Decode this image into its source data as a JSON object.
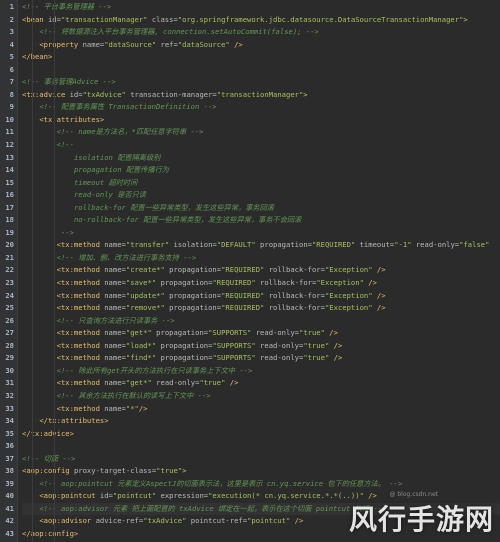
{
  "colors": {
    "background": "#2b2b2b",
    "gutter": "#313335",
    "tag": "#e8bf6a",
    "attribute": "#bababa",
    "value": "#a5c25c",
    "comment": "#629755"
  },
  "lines": [
    {
      "n": "1",
      "tokens": [
        [
          "cmt",
          "<!-- 平台事务管理器 -->"
        ]
      ]
    },
    {
      "n": "2",
      "tokens": [
        [
          "tag",
          "<bean "
        ],
        [
          "attr",
          "id="
        ],
        [
          "val",
          "\"transactionManager\""
        ],
        [
          "attr",
          " class="
        ],
        [
          "val",
          "\"org.springframework.jdbc.datasource.DataSourceTransactionManager\""
        ],
        [
          "tag",
          ">"
        ]
      ]
    },
    {
      "n": "3",
      "tokens": [
        [
          "plain",
          "    "
        ],
        [
          "cmt",
          "<!-- 将数据源注入平台事务管理器, connection.setAutoCommit(false); -->"
        ]
      ]
    },
    {
      "n": "4",
      "tokens": [
        [
          "plain",
          "    "
        ],
        [
          "tag",
          "<property "
        ],
        [
          "attr",
          "name="
        ],
        [
          "val",
          "\"dataSource\""
        ],
        [
          "attr",
          " ref="
        ],
        [
          "val",
          "\"dataSource\""
        ],
        [
          "tag",
          " />"
        ]
      ]
    },
    {
      "n": "5",
      "tokens": [
        [
          "tag",
          "</bean>"
        ]
      ]
    },
    {
      "n": "6",
      "tokens": []
    },
    {
      "n": "7",
      "tokens": [
        [
          "cmt",
          "<!-- 事务管理Advice -->"
        ]
      ]
    },
    {
      "n": "8",
      "tokens": [
        [
          "tag",
          "<tx:advice "
        ],
        [
          "attr",
          "id="
        ],
        [
          "val",
          "\"txAdvice\""
        ],
        [
          "attr",
          " transaction-manager="
        ],
        [
          "val",
          "\"transactionManager\""
        ],
        [
          "tag",
          ">"
        ]
      ]
    },
    {
      "n": "9",
      "tokens": [
        [
          "plain",
          "    "
        ],
        [
          "cmt",
          "<!-- 配置事务属性 TransactionDefinition -->"
        ]
      ]
    },
    {
      "n": "10",
      "tokens": [
        [
          "plain",
          "    "
        ],
        [
          "tag",
          "<tx:attributes>"
        ]
      ]
    },
    {
      "n": "11",
      "tokens": [
        [
          "plain",
          "        "
        ],
        [
          "cmt",
          "<!-- name是方法名，*匹配任意字符串 -->"
        ]
      ]
    },
    {
      "n": "12",
      "tokens": [
        [
          "plain",
          "        "
        ],
        [
          "cmt",
          "<!--"
        ]
      ]
    },
    {
      "n": "13",
      "tokens": [
        [
          "plain",
          "            "
        ],
        [
          "cmt",
          "isolation 配置隔离级别"
        ]
      ]
    },
    {
      "n": "14",
      "tokens": [
        [
          "plain",
          "            "
        ],
        [
          "cmt",
          "propagation 配置传播行为"
        ]
      ]
    },
    {
      "n": "15",
      "tokens": [
        [
          "plain",
          "            "
        ],
        [
          "cmt",
          "timeout 超时时间"
        ]
      ]
    },
    {
      "n": "16",
      "tokens": [
        [
          "plain",
          "            "
        ],
        [
          "cmt",
          "read-only 是否只读"
        ]
      ]
    },
    {
      "n": "17",
      "tokens": [
        [
          "plain",
          "            "
        ],
        [
          "cmt",
          "rollback-for 配置一些异常类型，发生这些异常，事务回滚"
        ]
      ]
    },
    {
      "n": "18",
      "tokens": [
        [
          "plain",
          "            "
        ],
        [
          "cmt",
          "no-rollback-for 配置一些异常类型，发生这些异常，事务不会回滚"
        ]
      ]
    },
    {
      "n": "19",
      "tokens": [
        [
          "plain",
          "         "
        ],
        [
          "cmt",
          "-->"
        ]
      ]
    },
    {
      "n": "20",
      "tokens": [
        [
          "plain",
          "        "
        ],
        [
          "tag",
          "<tx:method "
        ],
        [
          "attr",
          "name="
        ],
        [
          "val",
          "\"transfer\""
        ],
        [
          "attr",
          " isolation="
        ],
        [
          "val",
          "\"DEFAULT\""
        ],
        [
          "attr",
          " propagation="
        ],
        [
          "val",
          "\"REQUIRED\""
        ],
        [
          "attr",
          " timeout="
        ],
        [
          "val",
          "\"-1\""
        ],
        [
          "attr",
          " read-only="
        ],
        [
          "val",
          "\"false\""
        ]
      ]
    },
    {
      "n": "21",
      "tokens": [
        [
          "plain",
          "        "
        ],
        [
          "cmt",
          "<!-- 增加、删、改方法进行事务支持 -->"
        ]
      ]
    },
    {
      "n": "22",
      "tokens": [
        [
          "plain",
          "        "
        ],
        [
          "tag",
          "<tx:method "
        ],
        [
          "attr",
          "name="
        ],
        [
          "val",
          "\"create*\""
        ],
        [
          "attr",
          " propagation="
        ],
        [
          "val",
          "\"REQUIRED\""
        ],
        [
          "attr",
          " rollback-for="
        ],
        [
          "val",
          "\"Exception\""
        ],
        [
          "tag",
          " />"
        ]
      ]
    },
    {
      "n": "23",
      "tokens": [
        [
          "plain",
          "        "
        ],
        [
          "tag",
          "<tx:method "
        ],
        [
          "attr",
          "name="
        ],
        [
          "val",
          "\"save*\""
        ],
        [
          "attr",
          " propagation="
        ],
        [
          "val",
          "\"REQUIRED\""
        ],
        [
          "attr",
          " rollback-for="
        ],
        [
          "val",
          "\"Exception\""
        ],
        [
          "tag",
          " />"
        ]
      ]
    },
    {
      "n": "24",
      "tokens": [
        [
          "plain",
          "        "
        ],
        [
          "tag",
          "<tx:method "
        ],
        [
          "attr",
          "name="
        ],
        [
          "val",
          "\"update*\""
        ],
        [
          "attr",
          " propagation="
        ],
        [
          "val",
          "\"REQUIRED\""
        ],
        [
          "attr",
          " rollback-for="
        ],
        [
          "val",
          "\"Exception\""
        ],
        [
          "tag",
          " />"
        ]
      ]
    },
    {
      "n": "25",
      "tokens": [
        [
          "plain",
          "        "
        ],
        [
          "tag",
          "<tx:method "
        ],
        [
          "attr",
          "name="
        ],
        [
          "val",
          "\"remove*\""
        ],
        [
          "attr",
          " propagation="
        ],
        [
          "val",
          "\"REQUIRED\""
        ],
        [
          "attr",
          " rollback-for="
        ],
        [
          "val",
          "\"Exception\""
        ],
        [
          "tag",
          " />"
        ]
      ]
    },
    {
      "n": "26",
      "tokens": [
        [
          "plain",
          "        "
        ],
        [
          "cmt",
          "<!-- 只查询方法进行只读事务 -->"
        ]
      ]
    },
    {
      "n": "27",
      "tokens": [
        [
          "plain",
          "        "
        ],
        [
          "tag",
          "<tx:method "
        ],
        [
          "attr",
          "name="
        ],
        [
          "val",
          "\"get*\""
        ],
        [
          "attr",
          " propagation="
        ],
        [
          "val",
          "\"SUPPORTS\""
        ],
        [
          "attr",
          " read-only="
        ],
        [
          "val",
          "\"true\""
        ],
        [
          "tag",
          " />"
        ]
      ]
    },
    {
      "n": "28",
      "tokens": [
        [
          "plain",
          "        "
        ],
        [
          "tag",
          "<tx:method "
        ],
        [
          "attr",
          "name="
        ],
        [
          "val",
          "\"load*\""
        ],
        [
          "attr",
          " propagation="
        ],
        [
          "val",
          "\"SUPPORTS\""
        ],
        [
          "attr",
          " read-only="
        ],
        [
          "val",
          "\"true\""
        ],
        [
          "tag",
          " />"
        ]
      ]
    },
    {
      "n": "29",
      "tokens": [
        [
          "plain",
          "        "
        ],
        [
          "tag",
          "<tx:method "
        ],
        [
          "attr",
          "name="
        ],
        [
          "val",
          "\"find*\""
        ],
        [
          "attr",
          " propagation="
        ],
        [
          "val",
          "\"SUPPORTS\""
        ],
        [
          "attr",
          " read-only="
        ],
        [
          "val",
          "\"true\""
        ],
        [
          "tag",
          " />"
        ]
      ]
    },
    {
      "n": "30",
      "tokens": [
        [
          "plain",
          "        "
        ],
        [
          "cmt",
          "<!-- 除此所有get开头的方法执行在只读事务上下文中 -->"
        ]
      ]
    },
    {
      "n": "31",
      "tokens": [
        [
          "plain",
          "        "
        ],
        [
          "tag",
          "<tx:method "
        ],
        [
          "attr",
          "name="
        ],
        [
          "val",
          "\"get*\""
        ],
        [
          "attr",
          " read-only="
        ],
        [
          "val",
          "\"true\""
        ],
        [
          "tag",
          " />"
        ]
      ]
    },
    {
      "n": "32",
      "tokens": [
        [
          "plain",
          "        "
        ],
        [
          "cmt",
          "<!-- 其余方法执行在默认的读写上下文中 -->"
        ]
      ]
    },
    {
      "n": "33",
      "tokens": [
        [
          "plain",
          "        "
        ],
        [
          "tag",
          "<tx:method "
        ],
        [
          "attr",
          "name="
        ],
        [
          "val",
          "\"*\""
        ],
        [
          "tag",
          "/>"
        ]
      ]
    },
    {
      "n": "34",
      "tokens": [
        [
          "plain",
          "    "
        ],
        [
          "tag",
          "</tx:attributes>"
        ]
      ]
    },
    {
      "n": "35",
      "tokens": [
        [
          "tag",
          "</tx:advice>"
        ]
      ]
    },
    {
      "n": "36",
      "tokens": []
    },
    {
      "n": "37",
      "tokens": [
        [
          "cmt",
          "<!-- 切面 -->"
        ]
      ]
    },
    {
      "n": "38",
      "tokens": [
        [
          "tag",
          "<aop:config "
        ],
        [
          "attr",
          "proxy-target-class="
        ],
        [
          "val",
          "\"true\""
        ],
        [
          "tag",
          ">"
        ]
      ]
    },
    {
      "n": "39",
      "tokens": [
        [
          "plain",
          "    "
        ],
        [
          "cmt",
          "<!-- aop:pointcut 元素定义AspectJ的切面表示法，这里是表示 cn.yq.service 包下的任意方法。 -->"
        ]
      ]
    },
    {
      "n": "40",
      "tokens": [
        [
          "plain",
          "    "
        ],
        [
          "tag",
          "<aop:pointcut "
        ],
        [
          "attr",
          "id="
        ],
        [
          "val",
          "\"pointcut\""
        ],
        [
          "attr",
          " expression="
        ],
        [
          "val",
          "\"execution(* cn.yq.service.*.*(..))\""
        ],
        [
          "tag",
          " />"
        ]
      ]
    },
    {
      "n": "41",
      "tokens": [
        [
          "plain",
          "    "
        ],
        [
          "cmt",
          "<!-- aop:advisor 元素 把上面配置的 txAdvice 绑定在一起，表示在这个切面 pointcut 执行 -->"
        ]
      ]
    },
    {
      "n": "42",
      "tokens": [
        [
          "plain",
          "    "
        ],
        [
          "tag",
          "<aop:advisor "
        ],
        [
          "attr",
          "advice-ref="
        ],
        [
          "val",
          "\"txAdvice\""
        ],
        [
          "attr",
          " pointcut-ref="
        ],
        [
          "val",
          "\"pointcut\""
        ],
        [
          "tag",
          " />"
        ]
      ]
    },
    {
      "n": "43",
      "tokens": [
        [
          "tag",
          "</aop:config>"
        ]
      ]
    }
  ],
  "highlight_rows": [
    "41"
  ],
  "watermark": {
    "logo_text": "风行手游网",
    "small_text": "@ blog.csdn.net"
  }
}
